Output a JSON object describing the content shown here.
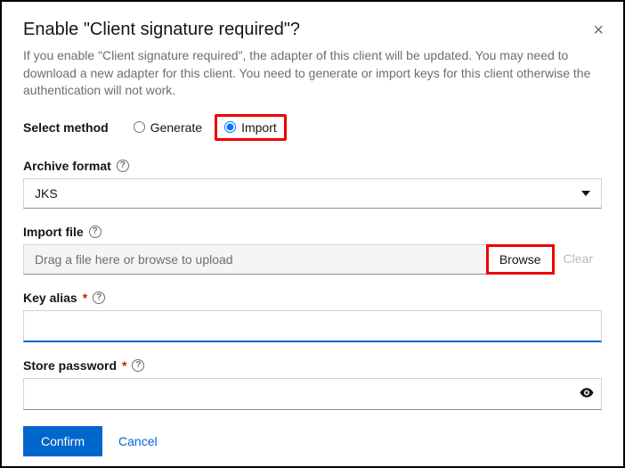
{
  "dialog": {
    "title": "Enable \"Client signature required\"?",
    "description": "If you enable \"Client signature required\", the adapter of this client will be updated. You may need to download a new adapter for this client. You need to generate or import keys for this client otherwise the authentication will not work."
  },
  "method": {
    "label": "Select method",
    "options": {
      "generate": "Generate",
      "import": "Import"
    },
    "selected": "import"
  },
  "archive_format": {
    "label": "Archive format",
    "value": "JKS"
  },
  "import_file": {
    "label": "Import file",
    "placeholder": "Drag a file here or browse to upload",
    "browse": "Browse",
    "clear": "Clear"
  },
  "key_alias": {
    "label": "Key alias",
    "value": ""
  },
  "store_password": {
    "label": "Store password",
    "value": ""
  },
  "footer": {
    "confirm": "Confirm",
    "cancel": "Cancel"
  }
}
